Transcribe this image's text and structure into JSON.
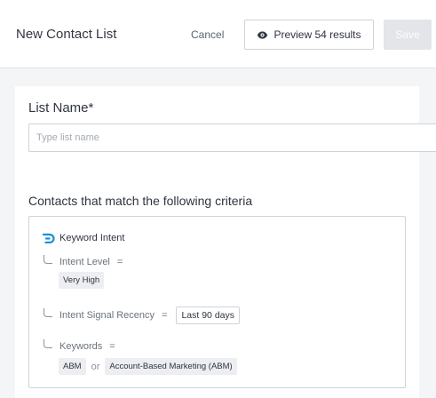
{
  "header": {
    "title": "New Contact List",
    "cancel_label": "Cancel",
    "preview_label": "Preview 54 results",
    "save_label": "Save"
  },
  "form": {
    "list_name_label": "List Name*",
    "list_name_placeholder": "Type list name",
    "list_name_value": "",
    "criteria_heading": "Contacts that match the following criteria"
  },
  "criteria": {
    "group_label": "Keyword Intent",
    "group_icon": "bombora-logo-icon",
    "rows": [
      {
        "label": "Intent Level",
        "operator": "=",
        "values": [
          "Very High"
        ]
      },
      {
        "label": "Intent Signal Recency",
        "operator": "=",
        "dropdown_value": "Last 90 days"
      },
      {
        "label": "Keywords",
        "operator": "=",
        "values": [
          "ABM",
          "Account-Based Marketing (ABM)"
        ],
        "joiner": "or"
      }
    ]
  },
  "colors": {
    "accent": "#1a8fd8",
    "save_disabled_bg": "#e3e5e8",
    "page_bg": "#f4f5f7"
  }
}
